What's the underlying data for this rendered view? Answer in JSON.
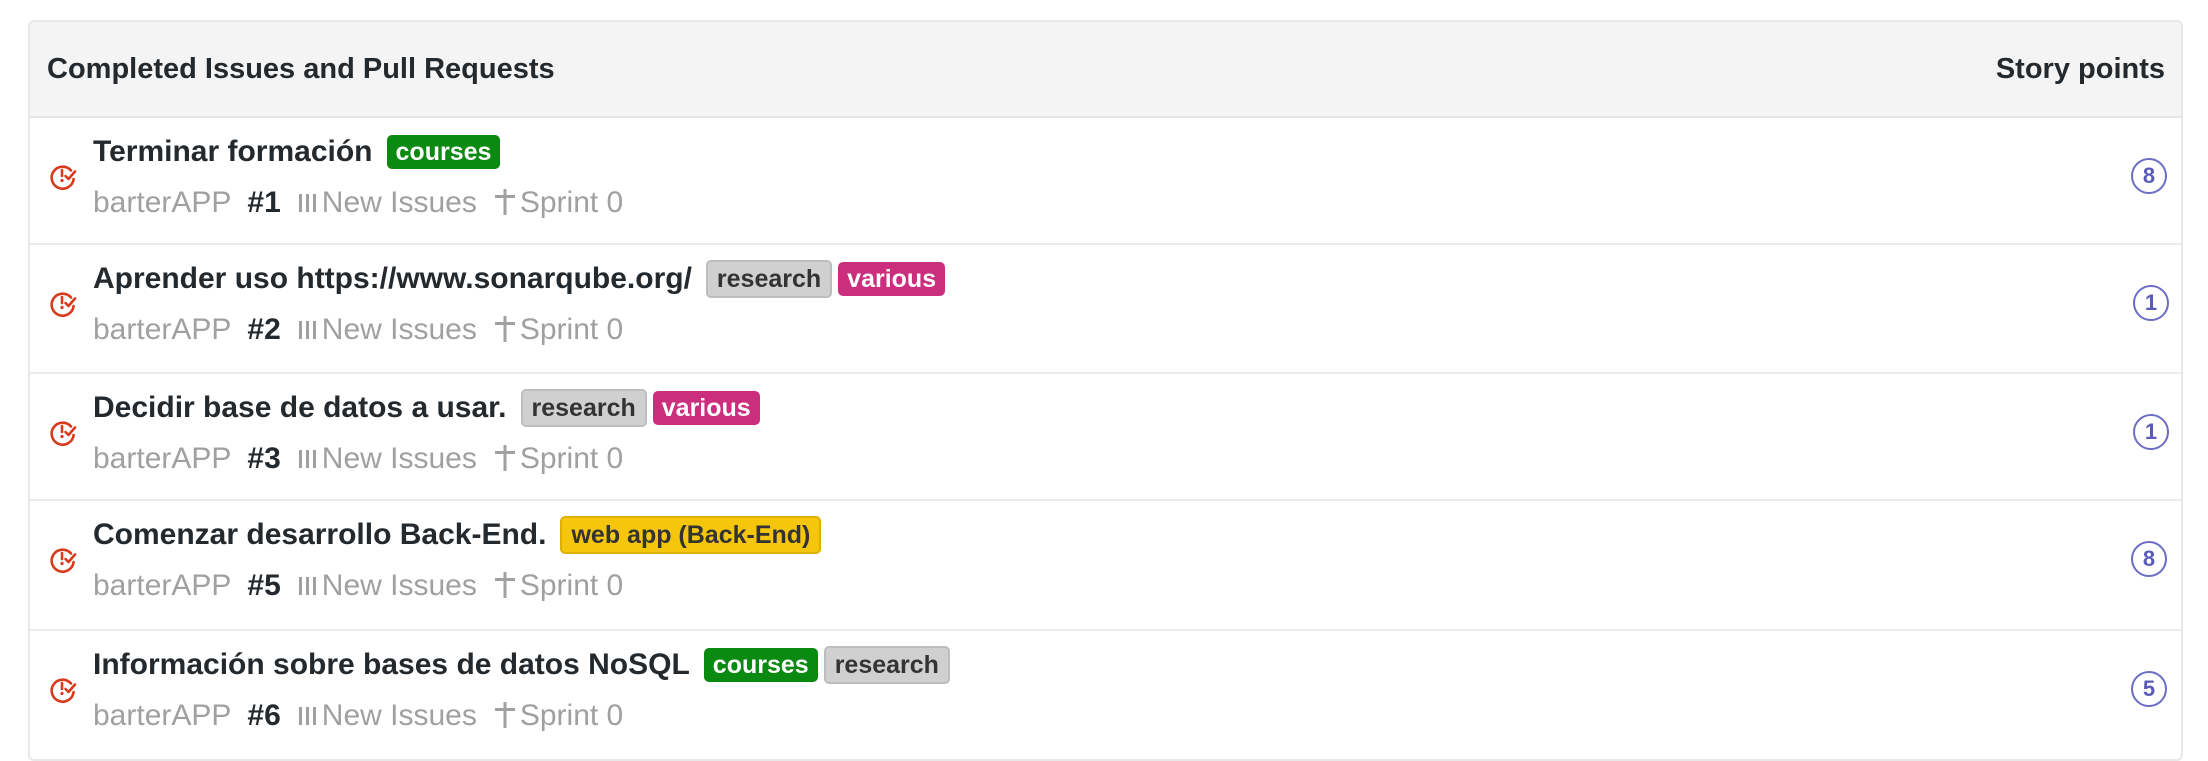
{
  "header": {
    "title": "Completed Issues and Pull Requests",
    "points_title": "Story points"
  },
  "colors": {
    "issue_icon": "#d73a1c",
    "points": "#6c6ec6"
  },
  "rows": [
    {
      "title": "Terminar formación",
      "labels": [
        {
          "text": "courses",
          "bg": "#0b8a12",
          "fg": "#ffffff"
        }
      ],
      "repo": "barterAPP",
      "number": "#1",
      "pipeline": "New Issues",
      "milestone": "Sprint 0",
      "points": "8",
      "icon": "closed-issue-icon"
    },
    {
      "title": "Aprender uso https://www.sonarqube.org/",
      "labels": [
        {
          "text": "research",
          "bg": "#d0d0d0",
          "fg": "#333333"
        },
        {
          "text": "various",
          "bg": "#cc2e7e",
          "fg": "#ffffff"
        }
      ],
      "repo": "barterAPP",
      "number": "#2",
      "pipeline": "New Issues",
      "milestone": "Sprint 0",
      "points": "1",
      "icon": "closed-issue-icon"
    },
    {
      "title": "Decidir base de datos a usar.",
      "labels": [
        {
          "text": "research",
          "bg": "#d0d0d0",
          "fg": "#333333"
        },
        {
          "text": "various",
          "bg": "#cc2e7e",
          "fg": "#ffffff"
        }
      ],
      "repo": "barterAPP",
      "number": "#3",
      "pipeline": "New Issues",
      "milestone": "Sprint 0",
      "points": "1",
      "icon": "closed-issue-icon"
    },
    {
      "title": "Comenzar desarrollo Back-End.",
      "labels": [
        {
          "text": "web app (Back-End)",
          "bg": "#f5c60c",
          "fg": "#333333"
        }
      ],
      "repo": "barterAPP",
      "number": "#5",
      "pipeline": "New Issues",
      "milestone": "Sprint 0",
      "points": "8",
      "icon": "closed-issue-icon"
    },
    {
      "title": "Información sobre bases de datos NoSQL",
      "labels": [
        {
          "text": "courses",
          "bg": "#0b8a12",
          "fg": "#ffffff"
        },
        {
          "text": "research",
          "bg": "#d0d0d0",
          "fg": "#333333"
        }
      ],
      "repo": "barterAPP",
      "number": "#6",
      "pipeline": "New Issues",
      "milestone": "Sprint 0",
      "points": "5",
      "icon": "closed-issue-icon"
    }
  ]
}
